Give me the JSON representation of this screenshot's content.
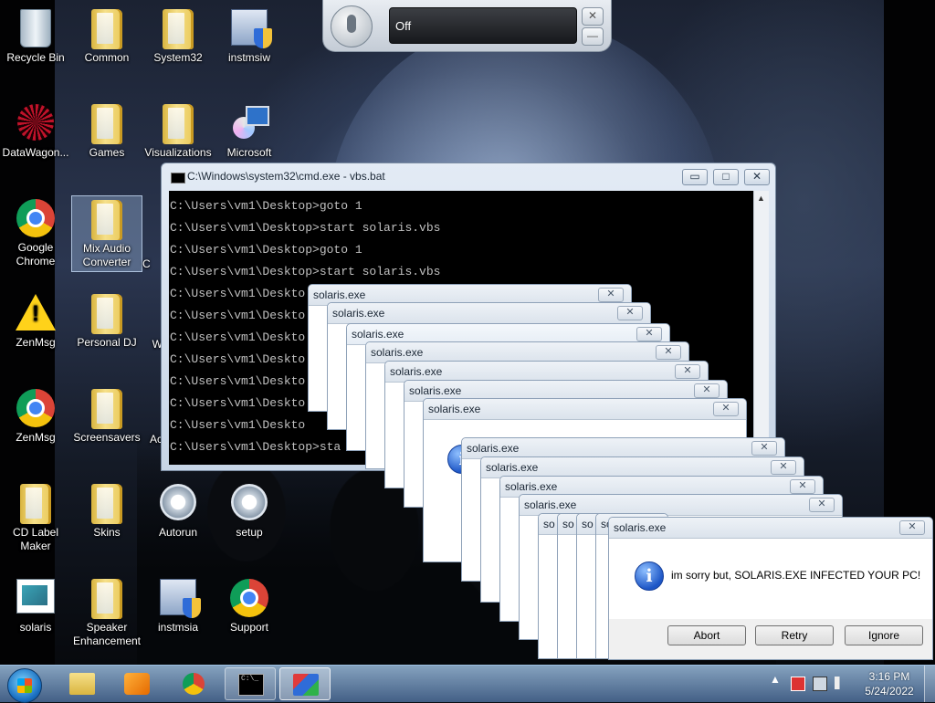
{
  "desktop": {
    "icons": [
      {
        "label": "Recycle Bin",
        "icon": "recycle-bin-icon"
      },
      {
        "label": "Common",
        "icon": "folder-icon"
      },
      {
        "label": "System32",
        "icon": "folder-icon"
      },
      {
        "label": "instmsiw",
        "icon": "installer-icon"
      },
      {
        "label": "DataWagon...",
        "icon": "datawagon-icon"
      },
      {
        "label": "Games",
        "icon": "folder-icon"
      },
      {
        "label": "Visualizations",
        "icon": "folder-icon"
      },
      {
        "label": "Microsoft",
        "icon": "microsoft-setup-icon"
      },
      {
        "label": "Google Chrome",
        "icon": "chrome-icon"
      },
      {
        "label": "Mix Audio Converter",
        "icon": "folder-icon"
      },
      {
        "label": "ZenMsg",
        "icon": "warning-icon"
      },
      {
        "label": "Personal DJ",
        "icon": "folder-icon"
      },
      {
        "label": "ZenMsg",
        "icon": "chrome-icon"
      },
      {
        "label": "Screensavers",
        "icon": "folder-icon"
      },
      {
        "label": "CD Label Maker",
        "icon": "folder-icon"
      },
      {
        "label": "Skins",
        "icon": "folder-icon"
      },
      {
        "label": "Autorun",
        "icon": "gear-file-icon"
      },
      {
        "label": "setup",
        "icon": "gear-file-icon"
      },
      {
        "label": "solaris",
        "icon": "solaris-icon"
      },
      {
        "label": "Speaker Enhancement",
        "icon": "folder-icon"
      },
      {
        "label": "instmsia",
        "icon": "installer-icon"
      },
      {
        "label": "Support",
        "icon": "chrome-icon"
      }
    ],
    "partial_labels": [
      "C",
      "W",
      "Ac"
    ]
  },
  "speech": {
    "status": "Off",
    "close_glyph": "✕",
    "minimize_glyph": "—"
  },
  "cmd": {
    "title": "C:\\Windows\\system32\\cmd.exe - vbs.bat",
    "minimize_glyph": "▭",
    "maximize_glyph": "□",
    "close_glyph": "✕",
    "lines": [
      "C:\\Users\\vm1\\Desktop>goto 1",
      "C:\\Users\\vm1\\Desktop>start solaris.vbs",
      "C:\\Users\\vm1\\Desktop>goto 1",
      "C:\\Users\\vm1\\Desktop>start solaris.vbs",
      "C:\\Users\\vm1\\Deskto",
      "C:\\Users\\vm1\\Deskto",
      "C:\\Users\\vm1\\Deskto",
      "C:\\Users\\vm1\\Deskto",
      "C:\\Users\\vm1\\Deskto",
      "C:\\Users\\vm1\\Deskto",
      "C:\\Users\\vm1\\Deskto",
      "C:\\Users\\vm1\\Desktop>sta"
    ]
  },
  "popups": {
    "title": "solaris.exe",
    "title_clipped": "so",
    "close_glyph": "✕"
  },
  "dialog": {
    "title": "solaris.exe",
    "message": "im sorry but, SOLARIS.EXE INFECTED YOUR PC!",
    "icon": "i",
    "close_glyph": "✕",
    "buttons": {
      "abort": "Abort",
      "retry": "Retry",
      "ignore": "Ignore"
    }
  },
  "taskbar": {
    "time": "3:16 PM",
    "date": "5/24/2022",
    "tray_arrow": "▲",
    "cmd_glyph": "C:\\_"
  }
}
